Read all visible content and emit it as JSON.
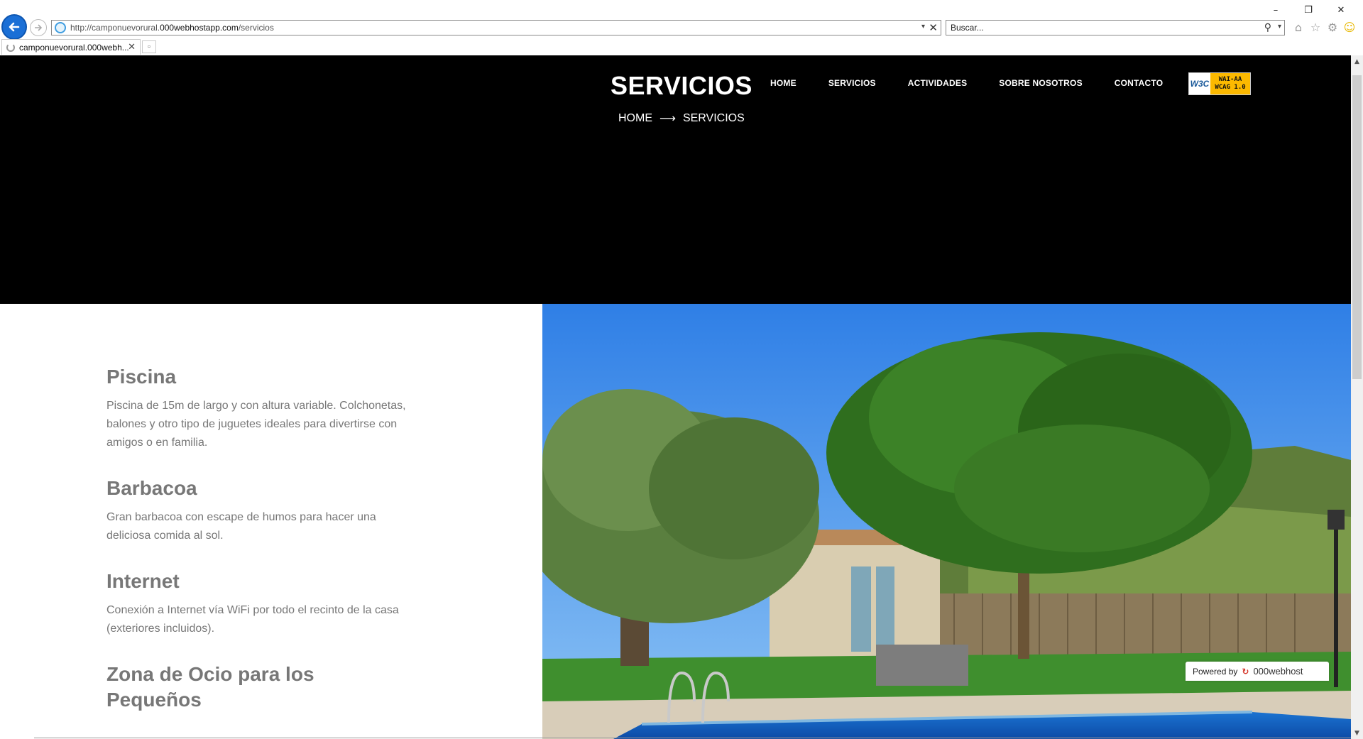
{
  "browser": {
    "url_prefix": "http://camponuevorural.",
    "url_domain": "000webhostapp.com",
    "url_path": "/servicios",
    "search_placeholder": "Buscar...",
    "tab_title": "camponuevorural.000webh...",
    "window_controls": [
      "–",
      "❐",
      "✕"
    ],
    "toolbar_icons": [
      "home-icon",
      "star-icon",
      "gear-icon",
      "smiley-icon"
    ]
  },
  "header": {
    "title": "SERVICIOS",
    "breadcrumb": {
      "home": "HOME",
      "current": "SERVICIOS"
    },
    "nav": [
      "HOME",
      "SERVICIOS",
      "ACTIVIDADES",
      "SOBRE NOSOTROS",
      "CONTACTO"
    ],
    "badge": {
      "w3c": "W3C",
      "line1": "WAI-AA",
      "line2": "WCAG 1.0"
    }
  },
  "services": [
    {
      "title": "Piscina",
      "text": "Piscina de 15m de largo y con altura variable. Colchonetas, balones y otro tipo de juguetes ideales para divertirse con amigos o en familia."
    },
    {
      "title": "Barbacoa",
      "text": "Gran barbacoa con escape de humos para hacer una deliciosa comida al sol."
    },
    {
      "title": "Internet",
      "text": "Conexión a Internet vía WiFi por todo el recinto de la casa (exteriores incluidos)."
    },
    {
      "title": "Zona de Ocio para los Pequeños",
      "text": ""
    }
  ],
  "footer": {
    "powered_by": "Powered by",
    "host_brand": "000webhost"
  },
  "colors": {
    "hero_bg": "#000000",
    "heading_gray": "#777777",
    "browser_back_blue": "#1a6fd6"
  }
}
